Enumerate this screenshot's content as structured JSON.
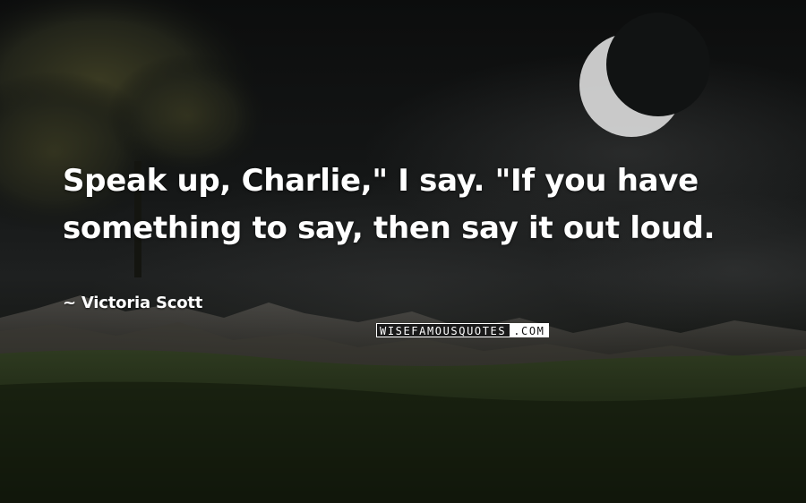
{
  "quote": {
    "text": "Speak up, Charlie,\" I say. \"If you have something to say, then say it out loud."
  },
  "author": {
    "prefix": "~",
    "name": "Victoria Scott"
  },
  "watermark": {
    "main": "WISEFAMOUSQUOTES",
    "tld": ".COM"
  },
  "colors": {
    "text": "#ffffff",
    "sky": "#0c0d0d",
    "grass": "#2c3a1e",
    "moon": "#d8d8d8"
  },
  "icons": [
    "crescent-moon-icon"
  ]
}
